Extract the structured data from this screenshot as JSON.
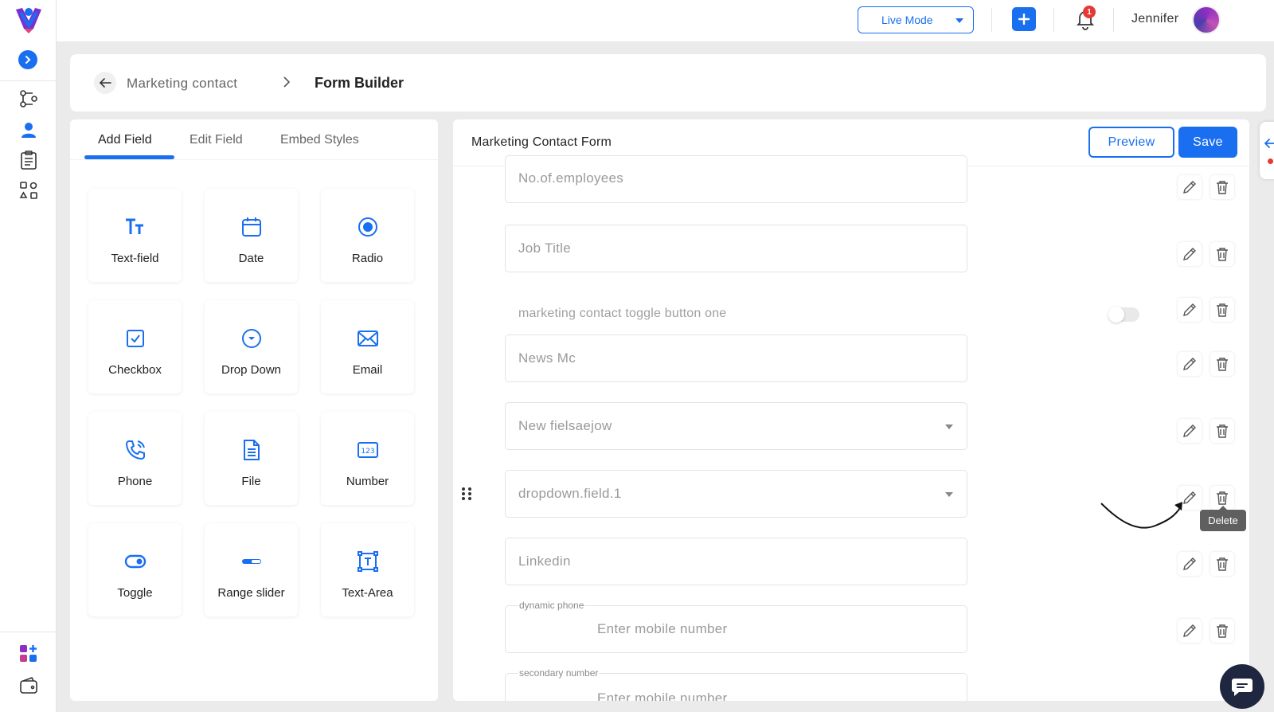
{
  "app": {
    "user_name": "Jennifer",
    "mode_label": "Live Mode",
    "notification_count": "1"
  },
  "colors": {
    "accent": "#1a6ff0",
    "badge": "#e53935",
    "sidebar_apps": "#8b2ec1"
  },
  "breadcrumb": {
    "parent": "Marketing contact",
    "current": "Form Builder"
  },
  "left_panel": {
    "tabs": [
      "Add Field",
      "Edit Field",
      "Embed Styles"
    ],
    "active_tab": "Add Field",
    "tiles": [
      "Text-field",
      "Date",
      "Radio",
      "Checkbox",
      "Drop Down",
      "Email",
      "Phone",
      "File",
      "Number",
      "Toggle",
      "Range slider",
      "Text-Area"
    ]
  },
  "form": {
    "title": "Marketing Contact Form",
    "preview_label": "Preview",
    "save_label": "Save",
    "fields": {
      "employees": "No.of.employees",
      "job_title": "Job Title",
      "toggle_label": "marketing contact toggle button one",
      "news": "News Mc",
      "new_field": "New fielsaejow",
      "dropdown": "dropdown.field.1",
      "linkedin": "Linkedin",
      "dynamic_phone_label": "dynamic phone",
      "dynamic_phone_placeholder": "Enter mobile number",
      "secondary_label": "secondary number",
      "secondary_placeholder": "Enter mobile number"
    },
    "tooltip": "Delete"
  },
  "icons": [
    "logo-icon",
    "expand-icon",
    "workflow-icon",
    "contacts-icon",
    "clipboard-icon",
    "integrations-icon",
    "apps-icon",
    "wallet-icon",
    "plus-icon",
    "bell-icon",
    "back-arrow-icon",
    "chevron-right-icon",
    "edit-icon",
    "delete-icon",
    "drag-handle-icon",
    "chat-icon"
  ]
}
